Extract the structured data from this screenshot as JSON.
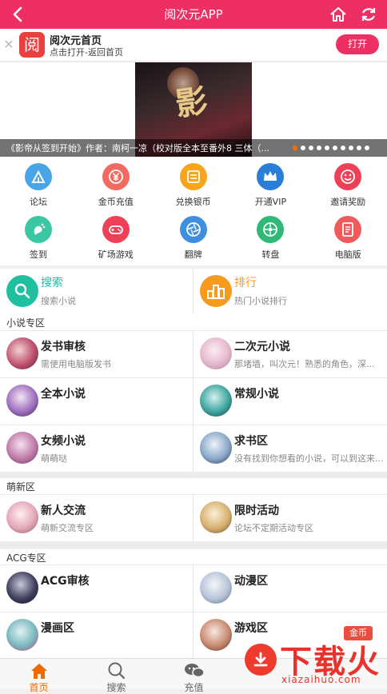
{
  "topbar": {
    "title": "阅次元APP"
  },
  "appbar": {
    "logo_char": "阅",
    "title": "阅次元首页",
    "subtitle": "点击打开-返回首页",
    "open_label": "打开"
  },
  "banner": {
    "cover_char": "影",
    "caption": "《影帝从签到开始》作者：南柯一凉（校对版全本至番外8 三体（...",
    "dot_count": 10,
    "active_dot": 0
  },
  "icons": [
    {
      "label": "论坛",
      "color": "#4aa5e8",
      "icon": "tent-icon"
    },
    {
      "label": "金币充值",
      "color": "#f26a62",
      "icon": "coin-yen-icon"
    },
    {
      "label": "兑换银币",
      "color": "#f7a51c",
      "icon": "exchange-icon"
    },
    {
      "label": "开通VIP",
      "color": "#2a7ed8",
      "icon": "crown-icon"
    },
    {
      "label": "邀请奖励",
      "color": "#ef4058",
      "icon": "smile-icon"
    },
    {
      "label": "签到",
      "color": "#3bc7a3",
      "icon": "foot-icon"
    },
    {
      "label": "矿场游戏",
      "color": "#ef4058",
      "icon": "gamepad-icon"
    },
    {
      "label": "翻牌",
      "color": "#3f8fe0",
      "icon": "aperture-icon"
    },
    {
      "label": "转盘",
      "color": "#2fb876",
      "icon": "wheel-icon"
    },
    {
      "label": "电脑版",
      "color": "#ef5a5a",
      "icon": "document-icon"
    }
  ],
  "nav": {
    "search": {
      "name": "搜索",
      "sub": "搜索小说",
      "color": "#1ec0a0"
    },
    "rank": {
      "name": "排行",
      "sub": "热门小说排行",
      "color": "#f79b1e"
    }
  },
  "sections": [
    {
      "title": "小说专区",
      "items": [
        {
          "name": "发书审核",
          "desc": "需使用电脑版发书"
        },
        {
          "name": "二次元小说",
          "desc": "那堵墙，叫次元！熟悉的角色，深..."
        },
        {
          "name": "全本小说",
          "desc": ""
        },
        {
          "name": "常规小说",
          "desc": ""
        },
        {
          "name": "女频小说",
          "desc": "萌萌哒"
        },
        {
          "name": "求书区",
          "desc": "没有找到你想看的小说，可以到这来..."
        }
      ]
    },
    {
      "title": "萌新区",
      "items": [
        {
          "name": "新人交流",
          "desc": "萌新交流专区"
        },
        {
          "name": "限时活动",
          "desc": "论坛不定期活动专区"
        }
      ]
    },
    {
      "title": "ACG专区",
      "items": [
        {
          "name": "ACG审核",
          "desc": ""
        },
        {
          "name": "动漫区",
          "desc": ""
        },
        {
          "name": "漫画区",
          "desc": ""
        },
        {
          "name": "游戏区",
          "desc": ""
        }
      ]
    }
  ],
  "tabs": [
    {
      "label": "首页",
      "icon": "home-icon",
      "active": true
    },
    {
      "label": "搜索",
      "icon": "search-icon",
      "active": false
    },
    {
      "label": "充值",
      "icon": "chat-icon",
      "active": false
    }
  ],
  "watermark": {
    "badge": "金币",
    "brand": "下载火",
    "url": "xiazaihuo.com"
  }
}
